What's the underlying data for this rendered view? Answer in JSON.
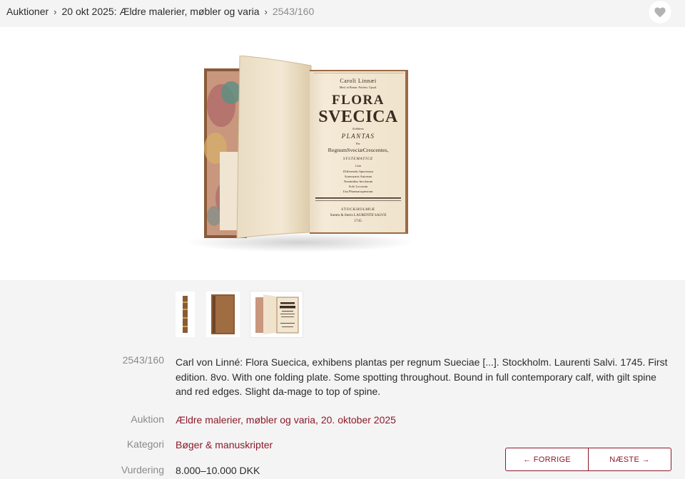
{
  "breadcrumb": {
    "items": [
      "Auktioner",
      "20 okt 2025: Ældre malerier, møbler og varia"
    ],
    "separator": "›",
    "current": "2543/160"
  },
  "favorite": {
    "icon": "heart-icon"
  },
  "main_image": {
    "title_page": {
      "author": "Caroli Linnæi",
      "author_sub": "Med. et Botan. Profess. Upsal.",
      "title1": "FLORA",
      "title2": "SVECICA",
      "exhibens": "Exhibens",
      "plantas": "PLANTAS",
      "per": "Per",
      "regnum": "RegnumSveciæCrescentes,",
      "systematice": "SYSTEMATICE",
      "cum": "Cum",
      "line1": "Differentiis Specierum",
      "line2": "Synonymis Autorum",
      "line3": "Nominibus Incolarum",
      "line4": "Solo Locorum",
      "line5": "Usu Pharmacopæorum.",
      "place": "STOCKHOLMIÆ",
      "printer": "Sumtu & literis LAURENTII SALVII",
      "year": "1745."
    }
  },
  "thumbnails": [
    "thumbnail-spine",
    "thumbnail-cover",
    "thumbnail-title-page"
  ],
  "details": {
    "lot_label": "2543/160",
    "description": "Carl von Linné: Flora Suecica, exhibens plantas per regnum Sueciae [...]. Stockholm. Laurenti Salvi. 1745. First edition. 8vo. With one folding plate. Some spotting throughout. Bound in full contemporary calf, with gilt spine and red edges. Slight da-mage to top of spine.",
    "auktion_label": "Auktion",
    "auktion_value": "Ældre malerier, møbler og varia, 20. oktober 2025",
    "kategori_label": "Kategori",
    "kategori_value": "Bøger & manuskripter",
    "vurdering_label": "Vurdering",
    "vurdering_value": "8.000–10.000 DKK"
  },
  "nav": {
    "prev": "← FORRIGE",
    "next": "NÆSTE →"
  },
  "colors": {
    "accent": "#8b1a2b",
    "background": "#f4f4f4",
    "muted": "#8a8a8a"
  }
}
